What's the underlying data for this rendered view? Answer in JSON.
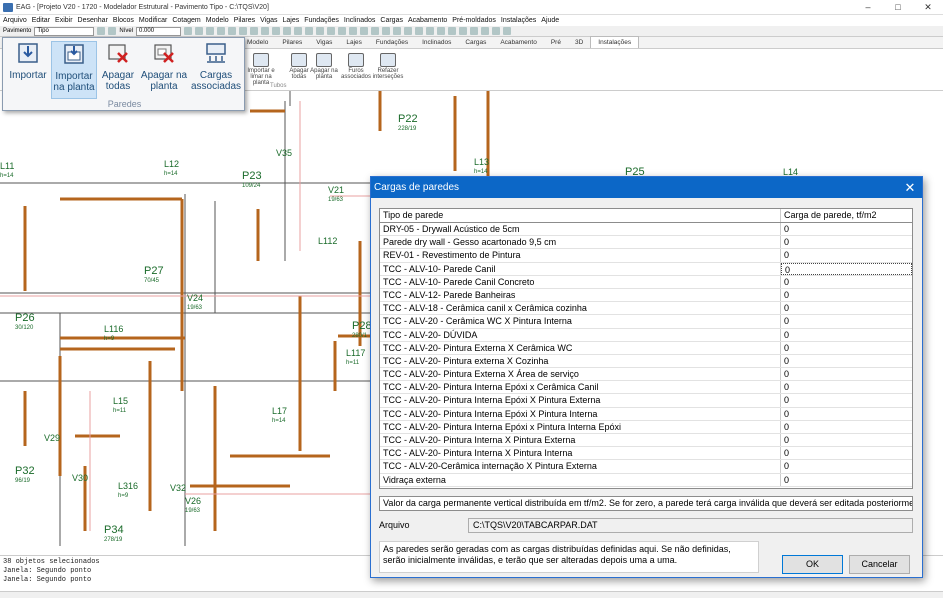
{
  "window": {
    "title": "EAG - [Projeto V20 - 1720 - Modelador Estrutural - Pavimento Tipo - C:\\TQS\\V20]",
    "min": "–",
    "max": "□",
    "close": "✕"
  },
  "menu": [
    "Arquivo",
    "Editar",
    "Exibir",
    "Desenhar",
    "Blocos",
    "Modificar",
    "Cotagem",
    "Modelo",
    "Pilares",
    "Vigas",
    "Lajes",
    "Fundações",
    "Inclinados",
    "Cargas",
    "Acabamento",
    "Pré-moldados",
    "Instalações",
    "Ajude"
  ],
  "toolbar": {
    "pavimento_label": "Pavimento",
    "pavimento_value": "Tipo",
    "nivel_label": "Nível",
    "nivel_value": "0.000"
  },
  "ribbon_tabs": [
    "Modelo",
    "Pilares",
    "Vigas",
    "Lajes",
    "Fundações",
    "Inclinados",
    "Cargas",
    "Acabamento",
    "Pré",
    "3D",
    "Instalações"
  ],
  "ribbon_active_tab": "Instalações",
  "ribbon_buttons": [
    "Importar e\nlimar na planta",
    "Apagar todas",
    "Apagar na planta",
    "Furos associados",
    "Refazer interseções"
  ],
  "ribbon_group_label": "Tubos",
  "flyout": {
    "buttons": [
      {
        "label": "Importar",
        "icon": "import-icon"
      },
      {
        "label": "Importar na planta",
        "icon": "import-plan-icon"
      },
      {
        "label": "Apagar todas",
        "icon": "delete-all-icon"
      },
      {
        "label": "Apagar na planta",
        "icon": "delete-plan-icon"
      },
      {
        "label": "Cargas associadas",
        "icon": "loads-icon"
      }
    ],
    "group": "Paredes"
  },
  "canvas_labels": [
    {
      "t": "P22",
      "s": "228/19"
    },
    {
      "t": "L12",
      "s": "h=14"
    },
    {
      "t": "L13",
      "s": "h=14"
    },
    {
      "t": "P23",
      "s": "109/24"
    },
    {
      "t": "V21",
      "s": "19/63"
    },
    {
      "t": "P25",
      "s": ""
    },
    {
      "t": "L14",
      "s": ""
    },
    {
      "t": "L11",
      "s": "h=14"
    },
    {
      "t": "P27",
      "s": "70/45"
    },
    {
      "t": "V24",
      "s": "19/63"
    },
    {
      "t": "P26",
      "s": "30/120"
    },
    {
      "t": "L116",
      "s": "h=9"
    },
    {
      "t": "L15",
      "s": "h=11"
    },
    {
      "t": "L117",
      "s": "h=11"
    },
    {
      "t": "L17",
      "s": "h=14"
    },
    {
      "t": "L316",
      "s": "h=9"
    },
    {
      "t": "P32",
      "s": "96/19"
    },
    {
      "t": "V26",
      "s": "19/63"
    },
    {
      "t": "P34",
      "s": "278/19"
    },
    {
      "t": "V29",
      "s": ""
    },
    {
      "t": "V30",
      "s": ""
    },
    {
      "t": "V32",
      "s": ""
    },
    {
      "t": "V35",
      "s": ""
    },
    {
      "t": "P28",
      "s": "280/1"
    },
    {
      "t": "L112",
      "s": ""
    }
  ],
  "command_lines": [
    "38 objetos selecionados",
    "Janela: Segundo ponto",
    "Janela: Segundo ponto"
  ],
  "dialog": {
    "title": "Cargas de paredes",
    "col_tipo": "Tipo de parede",
    "col_carga": "Carga de parede, tf/m2",
    "rows": [
      {
        "tipo": "DRY-05 - Drywall Acústico de 5cm",
        "carga": "0"
      },
      {
        "tipo": "Parede dry wall - Gesso acartonado 9,5 cm",
        "carga": "0"
      },
      {
        "tipo": "REV-01 - Revestimento de Pintura",
        "carga": "0"
      },
      {
        "tipo": "TCC - ALV-10- Parede Canil",
        "carga": "0"
      },
      {
        "tipo": "TCC - ALV-10- Parede Canil Concreto",
        "carga": "0"
      },
      {
        "tipo": "TCC - ALV-12- Parede Banheiras",
        "carga": "0"
      },
      {
        "tipo": "TCC - ALV-18 - Cerâmica canil x Cerâmica cozinha",
        "carga": "0"
      },
      {
        "tipo": "TCC - ALV-20 - Cerâmica WC X Pintura Interna",
        "carga": "0"
      },
      {
        "tipo": "TCC - ALV-20- DÚVIDA",
        "carga": "0"
      },
      {
        "tipo": "TCC - ALV-20- Pintura Externa X Cerâmica WC",
        "carga": "0"
      },
      {
        "tipo": "TCC - ALV-20- Pintura externa X Cozinha",
        "carga": "0"
      },
      {
        "tipo": "TCC - ALV-20- Pintura Externa X Área de serviço",
        "carga": "0"
      },
      {
        "tipo": "TCC - ALV-20- Pintura Interna Epóxi x Cerâmica Canil",
        "carga": "0"
      },
      {
        "tipo": "TCC - ALV-20- Pintura Interna Epóxi X Pintura Externa",
        "carga": "0"
      },
      {
        "tipo": "TCC - ALV-20- Pintura Interna Epóxi X Pintura Interna",
        "carga": "0"
      },
      {
        "tipo": "TCC - ALV-20- Pintura Interna Epóxi x Pintura Interna Epóxi",
        "carga": "0"
      },
      {
        "tipo": "TCC - ALV-20- Pintura Interna X Pintura Externa",
        "carga": "0"
      },
      {
        "tipo": "TCC - ALV-20- Pintura Interna X Pintura Interna",
        "carga": "0"
      },
      {
        "tipo": "TCC - ALV-20-Cerâmica internação  X Pintura Externa",
        "carga": "0"
      },
      {
        "tipo": "Vidraça externa",
        "carga": "0"
      }
    ],
    "hint": "Valor da carga permanente vertical distribuída em tf/m2. Se for zero, a parede terá carga inválida que deverá ser editada posteriormente",
    "arquivo_label": "Arquivo",
    "arquivo_value": "C:\\TQS\\V20\\TABCARPAR.DAT",
    "note": "As paredes serão geradas com as cargas distribuídas definidas aqui. Se não definidas, serão inicialmente inválidas, e terão que ser alteradas depois uma a uma.",
    "ok": "OK",
    "cancel": "Cancelar"
  },
  "colors": {
    "beam": "#b5651d",
    "grid_line": "#555555",
    "accent": "#0c67c7",
    "flyout_text": "#1f4e79"
  }
}
